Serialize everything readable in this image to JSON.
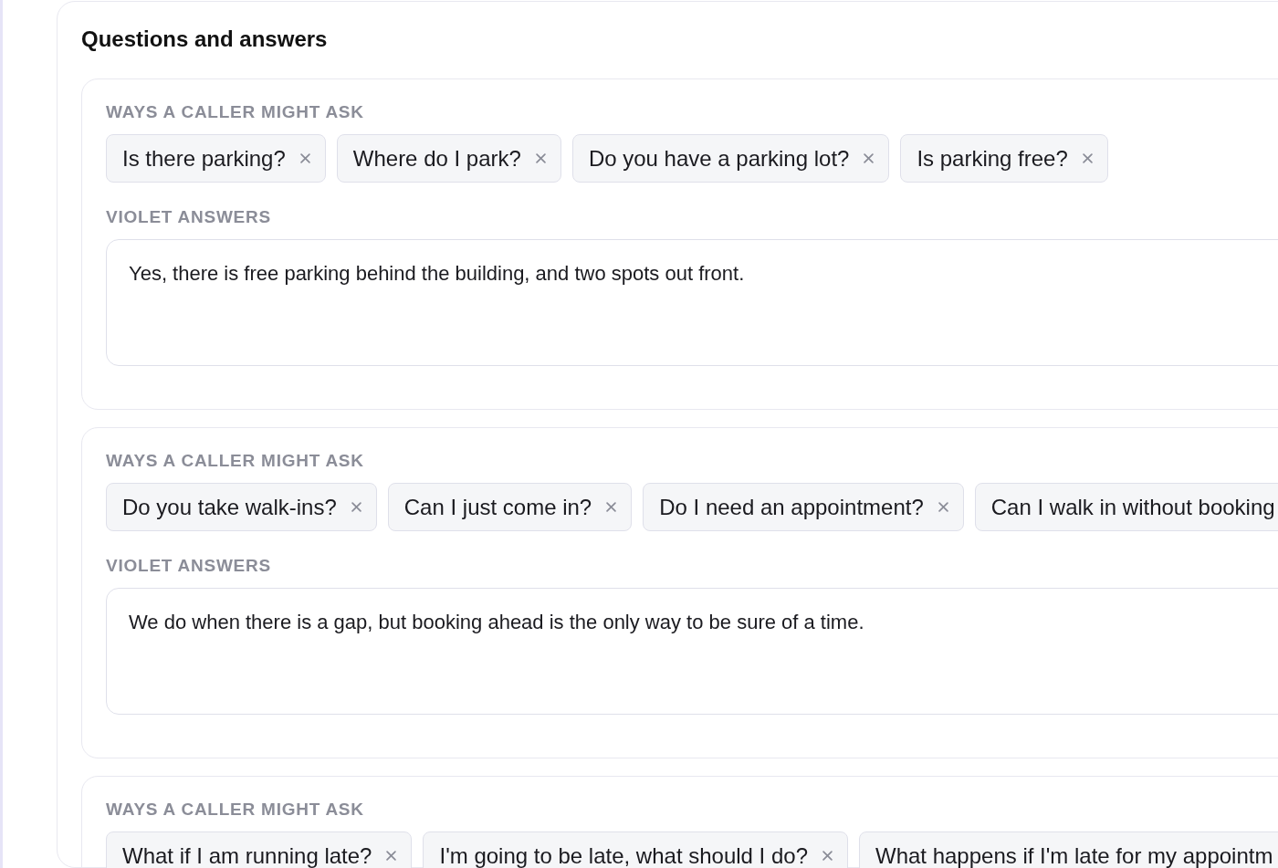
{
  "section": {
    "title": "Questions and answers",
    "items": [
      {
        "asks_label": "WAYS A CALLER MIGHT ASK",
        "phrasings": [
          {
            "text": "Is there parking?",
            "close_visible": true
          },
          {
            "text": "Where do I park?",
            "close_visible": true
          },
          {
            "text": "Do you have a parking lot?",
            "close_visible": true
          },
          {
            "text": "Is parking free?",
            "close_visible": true
          }
        ],
        "answer_label": "VIOLET ANSWERS",
        "answer": "Yes, there is free parking behind the building, and two spots out front."
      },
      {
        "asks_label": "WAYS A CALLER MIGHT ASK",
        "phrasings": [
          {
            "text": "Do you take walk-ins?",
            "close_visible": true
          },
          {
            "text": "Can I just come in?",
            "close_visible": true
          },
          {
            "text": "Do I need an appointment?",
            "close_visible": true
          },
          {
            "text": "Can I walk in without booking",
            "close_visible": false
          }
        ],
        "answer_label": "VIOLET ANSWERS",
        "answer": "We do when there is a gap, but booking ahead is the only way to be sure of a time."
      },
      {
        "asks_label": "WAYS A CALLER MIGHT ASK",
        "phrasings": [
          {
            "text": "What if I am running late?",
            "close_visible": true
          },
          {
            "text": "I'm going to be late, what should I do?",
            "close_visible": true
          },
          {
            "text": "What happens if I'm late for my appointm",
            "close_visible": false
          }
        ]
      }
    ]
  }
}
